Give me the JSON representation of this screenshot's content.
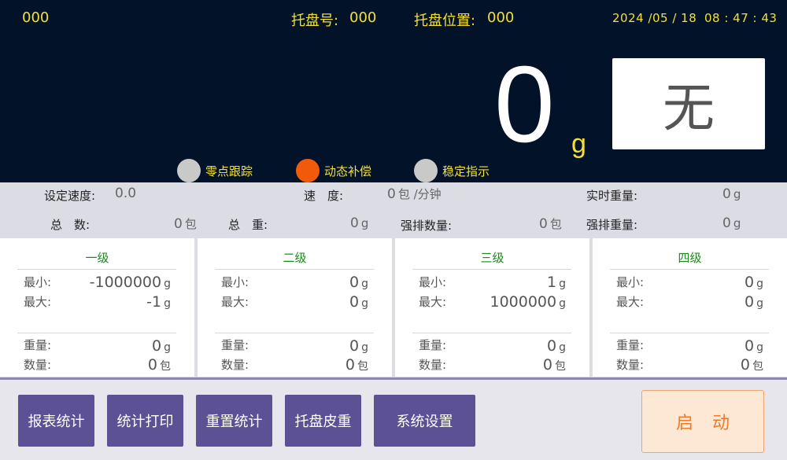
{
  "header": {
    "device_code": "000",
    "pallet_no_label": "托盘号:",
    "pallet_no_value": "000",
    "pallet_pos_label": "托盘位置:",
    "pallet_pos_value": "000",
    "date": "2024 /05 / 18",
    "time": "08 : 47 : 43"
  },
  "display": {
    "weight": "0",
    "unit": "g",
    "grade": "无"
  },
  "indicators": [
    {
      "label": "零点跟踪",
      "active": false
    },
    {
      "label": "动态补偿",
      "active": true
    },
    {
      "label": "稳定指示",
      "active": false
    }
  ],
  "info": {
    "set_speed_label": "设定速度:",
    "set_speed_value": "0.0",
    "speed_label": "速　度:",
    "speed_value": "0",
    "speed_unit": "包 /分钟",
    "realtime_weight_label": "实时重量:",
    "realtime_weight_value": "0",
    "realtime_weight_unit": "g",
    "total_count_label": "总　数:",
    "total_count_value": "0",
    "total_count_unit": "包",
    "total_weight_label": "总　重:",
    "total_weight_value": "0",
    "total_weight_unit": "g",
    "reject_count_label": "强排数量:",
    "reject_count_value": "0",
    "reject_count_unit": "包",
    "reject_weight_label": "强排重量:",
    "reject_weight_value": "0",
    "reject_weight_unit": "g"
  },
  "grades": [
    {
      "title": "一级",
      "min_label": "最小:",
      "min": "-1000000",
      "max_label": "最大:",
      "max": "-1",
      "weight_label": "重量:",
      "weight": "0",
      "count_label": "数量:",
      "count": "0"
    },
    {
      "title": "二级",
      "min_label": "最小:",
      "min": "0",
      "max_label": "最大:",
      "max": "0",
      "weight_label": "重量:",
      "weight": "0",
      "count_label": "数量:",
      "count": "0"
    },
    {
      "title": "三级",
      "min_label": "最小:",
      "min": "1",
      "max_label": "最大:",
      "max": "1000000",
      "weight_label": "重量:",
      "weight": "0",
      "count_label": "数量:",
      "count": "0"
    },
    {
      "title": "四级",
      "min_label": "最小:",
      "min": "0",
      "max_label": "最大:",
      "max": "0",
      "weight_label": "重量:",
      "weight": "0",
      "count_label": "数量:",
      "count": "0"
    }
  ],
  "grade_units": {
    "weight": "g",
    "count": "包"
  },
  "buttons": {
    "report": "报表统计",
    "print": "统计打印",
    "reset": "重置统计",
    "tare": "托盘皮重",
    "settings": "系统设置",
    "start": "启动"
  },
  "colors": {
    "display_bg": "#021229",
    "accent_yellow": "#f2e033",
    "active_indicator": "#f05a0a",
    "button_purple": "#5b5194",
    "start_orange": "#f07a2a",
    "grade_title_green": "#1a8a1a"
  }
}
